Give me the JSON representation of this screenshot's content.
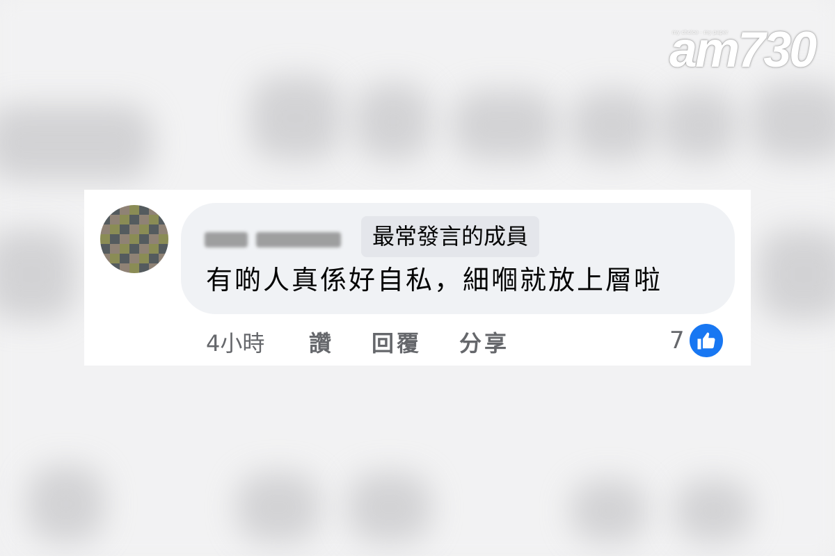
{
  "watermark": {
    "logo_text": "am730",
    "tagline": "my choice · my paper"
  },
  "comment": {
    "author": "",
    "badge": "最常發言的成員",
    "text": "有啲人真係好自私，細嗰就放上層啦",
    "time": "4小時",
    "actions": {
      "like": "讚",
      "reply": "回覆",
      "share": "分享"
    },
    "reaction_count": "7",
    "reaction_icon": "thumbs-up-icon"
  },
  "colors": {
    "bubble": "#f0f2f5",
    "badge": "#e4e6eb",
    "like_blue": "#1877f2",
    "meta_gray": "#65676b"
  }
}
